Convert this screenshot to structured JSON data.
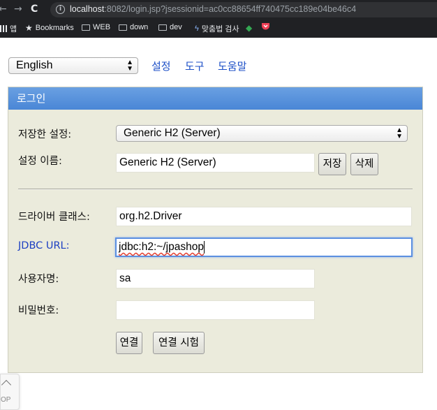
{
  "browser": {
    "url_host": "localhost",
    "url_rest": ":8082/login.jsp?jsessionid=ac0cc88654ff740475cc189e04be46c4",
    "bookmarks": [
      {
        "label": "앱"
      },
      {
        "label": "Bookmarks"
      },
      {
        "label": "WEB"
      },
      {
        "label": "down"
      },
      {
        "label": "dev"
      },
      {
        "label": "맞춤법 검사"
      }
    ]
  },
  "top": {
    "language_value": "English",
    "links": [
      "설정",
      "도구",
      "도움말"
    ]
  },
  "panel": {
    "title": "로그인",
    "saved_settings_label": "저장한 설정:",
    "saved_settings_value": "Generic H2 (Server)",
    "setting_name_label": "설정 이름:",
    "setting_name_value": "Generic H2 (Server)",
    "save_button": "저장",
    "delete_button": "삭제",
    "driver_class_label": "드라이버 클래스:",
    "driver_class_value": "org.h2.Driver",
    "jdbc_url_label": "JDBC URL:",
    "jdbc_url_value": "jdbc:h2:~/jpashop",
    "username_label": "사용자명:",
    "username_value": "sa",
    "password_label": "비밀번호:",
    "password_value": "",
    "connect_button": "연결",
    "test_connect_button": "연결 시험"
  },
  "scroll_top": {
    "label": "OP"
  },
  "colors": {
    "panel_header": "#4a86d6",
    "panel_bg": "#ebebdc",
    "link": "#1c4fc7",
    "focus": "#5b8fe0"
  }
}
